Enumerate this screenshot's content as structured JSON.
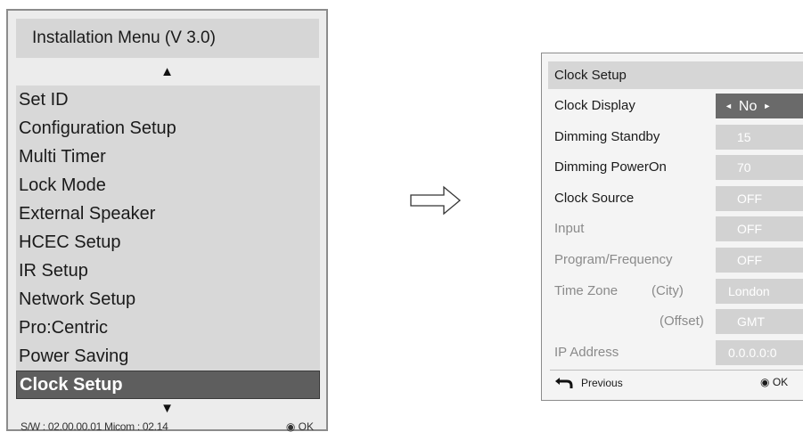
{
  "installation_menu": {
    "title": "Installation Menu (V 3.0)",
    "scroll_up_glyph": "▲",
    "scroll_down_glyph": "▼",
    "items": [
      {
        "label": "Set ID"
      },
      {
        "label": "Configuration Setup"
      },
      {
        "label": "Multi Timer"
      },
      {
        "label": "Lock Mode"
      },
      {
        "label": "External Speaker"
      },
      {
        "label": "HCEC Setup"
      },
      {
        "label": "IR Setup"
      },
      {
        "label": "Network Setup"
      },
      {
        "label": "Pro:Centric"
      },
      {
        "label": "Power Saving"
      },
      {
        "label": "Clock Setup",
        "selected": true
      }
    ],
    "footer_info": "S/W : 02.00.00.01 Micom : 02.14",
    "ok_icon": "radio-dot-icon",
    "ok_glyph": "◉",
    "ok_label": "OK"
  },
  "clock_setup": {
    "title": "Clock Setup",
    "rows": [
      {
        "label": "Clock Display",
        "sub": "",
        "value": "No",
        "enabled": true,
        "active": true
      },
      {
        "label": "Dimming Standby",
        "sub": "",
        "value": "15",
        "enabled": true
      },
      {
        "label": "Dimming PowerOn",
        "sub": "",
        "value": "70",
        "enabled": true
      },
      {
        "label": "Clock Source",
        "sub": "",
        "value": "OFF",
        "enabled": true
      },
      {
        "label": "Input",
        "sub": "",
        "value": "OFF",
        "enabled": false
      },
      {
        "label": "Program/Frequency",
        "sub": "",
        "value": "OFF",
        "enabled": false
      },
      {
        "label": "Time Zone",
        "sub": "(City)",
        "value": "London",
        "enabled": false
      },
      {
        "label": "",
        "sub": "(Offset)",
        "value": "GMT",
        "enabled": false
      },
      {
        "label": "IP Address",
        "sub": "",
        "value": "0.0.0.0:0",
        "enabled": false
      }
    ],
    "value_left_glyph": "◄",
    "value_right_glyph": "►",
    "previous_icon": "back-arrow-icon",
    "previous_label": "Previous",
    "ok_icon": "radio-dot-icon",
    "ok_glyph": "◉",
    "ok_label": "OK"
  },
  "flow_arrow_icon": "right-arrow-icon",
  "colors": {
    "panel_bg": "#ececec",
    "title_bg": "#d6d6d6",
    "selected_bg": "#5e5e5e",
    "value_bg": "#d2d2d2",
    "active_value_bg": "#6a6a6a",
    "disabled_text": "#8a8a8a"
  }
}
